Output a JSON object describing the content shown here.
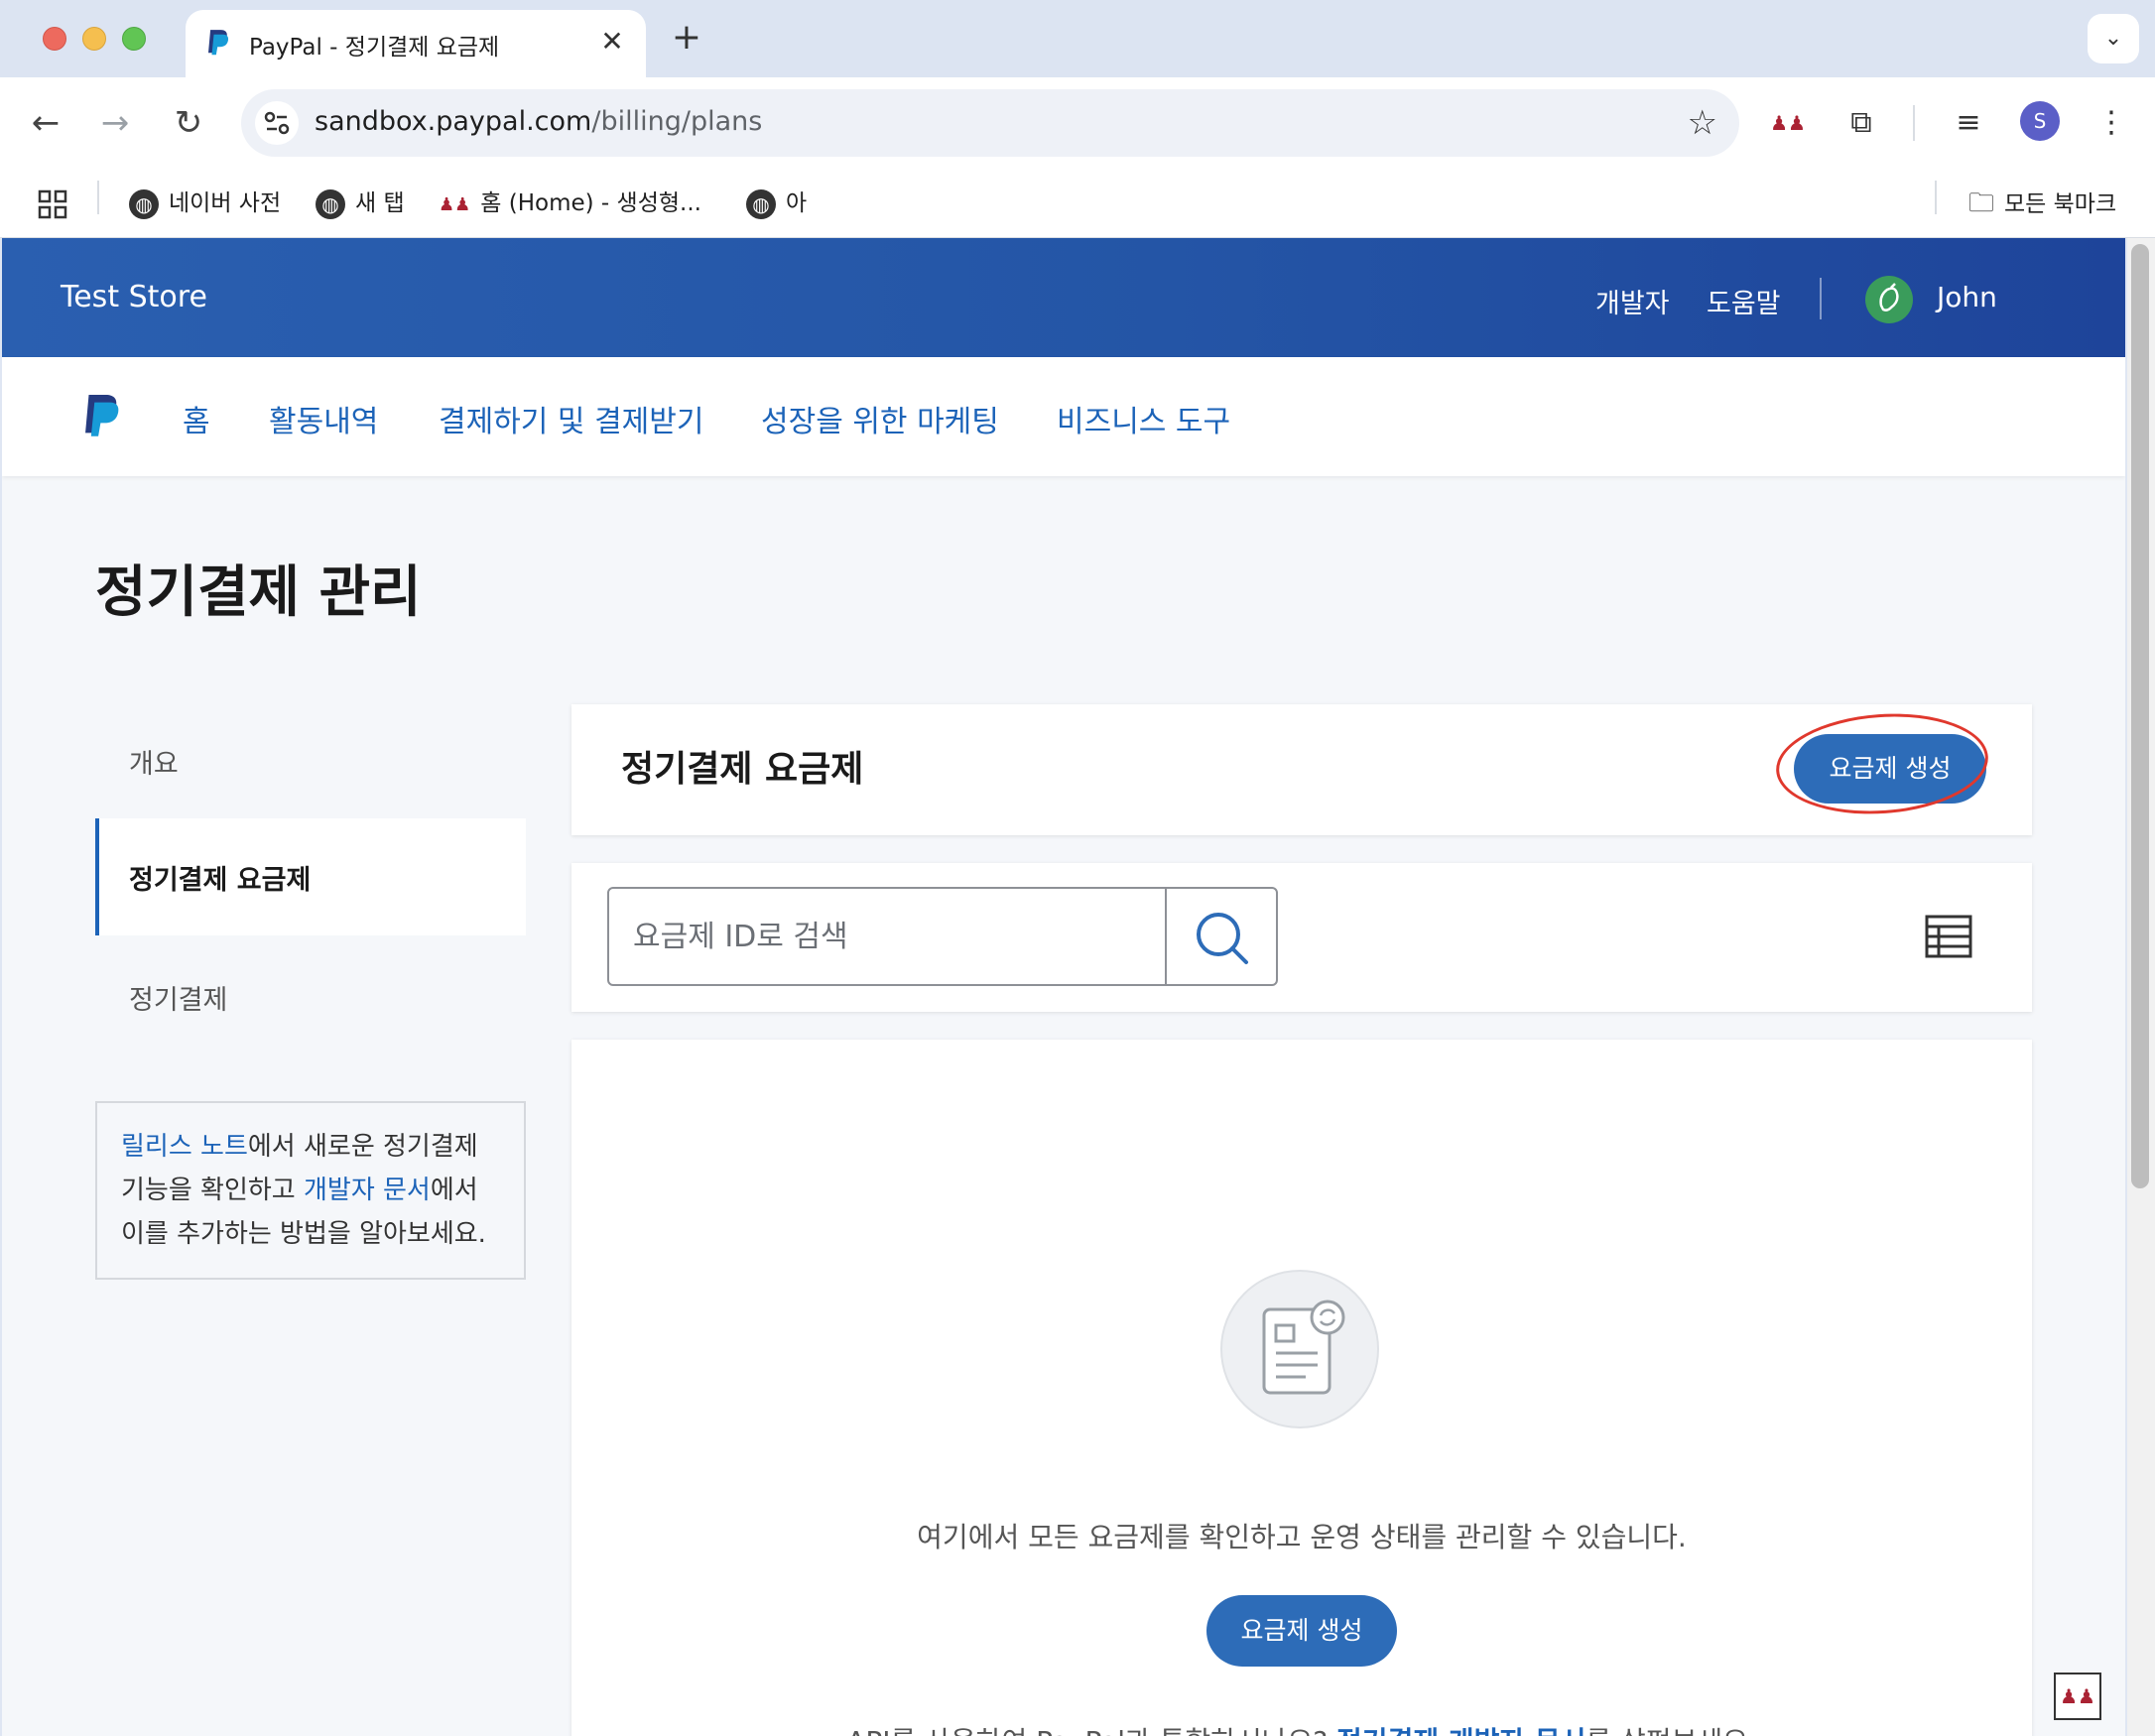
{
  "browser": {
    "tab_title": "PayPal - 정기결제 요금제",
    "tab_close": "✕",
    "new_tab": "+",
    "tab_menu": "⌄",
    "url_host": "sandbox.paypal.com",
    "url_path": "/billing/plans",
    "profile_initial": "S",
    "bookmarks": [
      "네이버 사전",
      "새 탭",
      "홈 (Home) - 생성형...",
      "아"
    ],
    "all_bookmarks": "모든 북마크"
  },
  "header": {
    "store_name": "Test Store",
    "developer_link": "개발자",
    "help_link": "도움말",
    "user_name": "John"
  },
  "main_nav": {
    "items": [
      "홈",
      "활동내역",
      "결제하기 및 결제받기",
      "성장을 위한 마케팅",
      "비즈니스 도구"
    ]
  },
  "page": {
    "title": "정기결제 관리"
  },
  "sidebar": {
    "items": [
      "개요",
      "정기결제 요금제",
      "정기결제"
    ],
    "active_index": 1,
    "info": {
      "link1": "릴리스 노트",
      "text1": "에서 새로운 정기결제",
      "text2": "기능을 확인하고 ",
      "link2": "개발자 문서",
      "text3": "에서",
      "text4": "이를 추가하는 방법을 알아보세요."
    }
  },
  "plans_card": {
    "title": "정기결제 요금제",
    "create_button": "요금제 생성"
  },
  "search": {
    "placeholder": "요금제 ID로 검색"
  },
  "empty_state": {
    "message": "여기에서 모든 요금제를 확인하고 운영 상태를 관리할 수 있습니다.",
    "create_button": "요금제 생성",
    "api_text_before": "API를 사용하여 PayPal과 통합하시나요? ",
    "api_link": "정기결제 개발자 문서",
    "api_text_after": "를 살펴보세요."
  },
  "colors": {
    "brand_blue": "#2d6cb8",
    "header_blue": "#2455a6",
    "link_blue": "#1c63b8",
    "annotation_red": "#e0382d"
  }
}
